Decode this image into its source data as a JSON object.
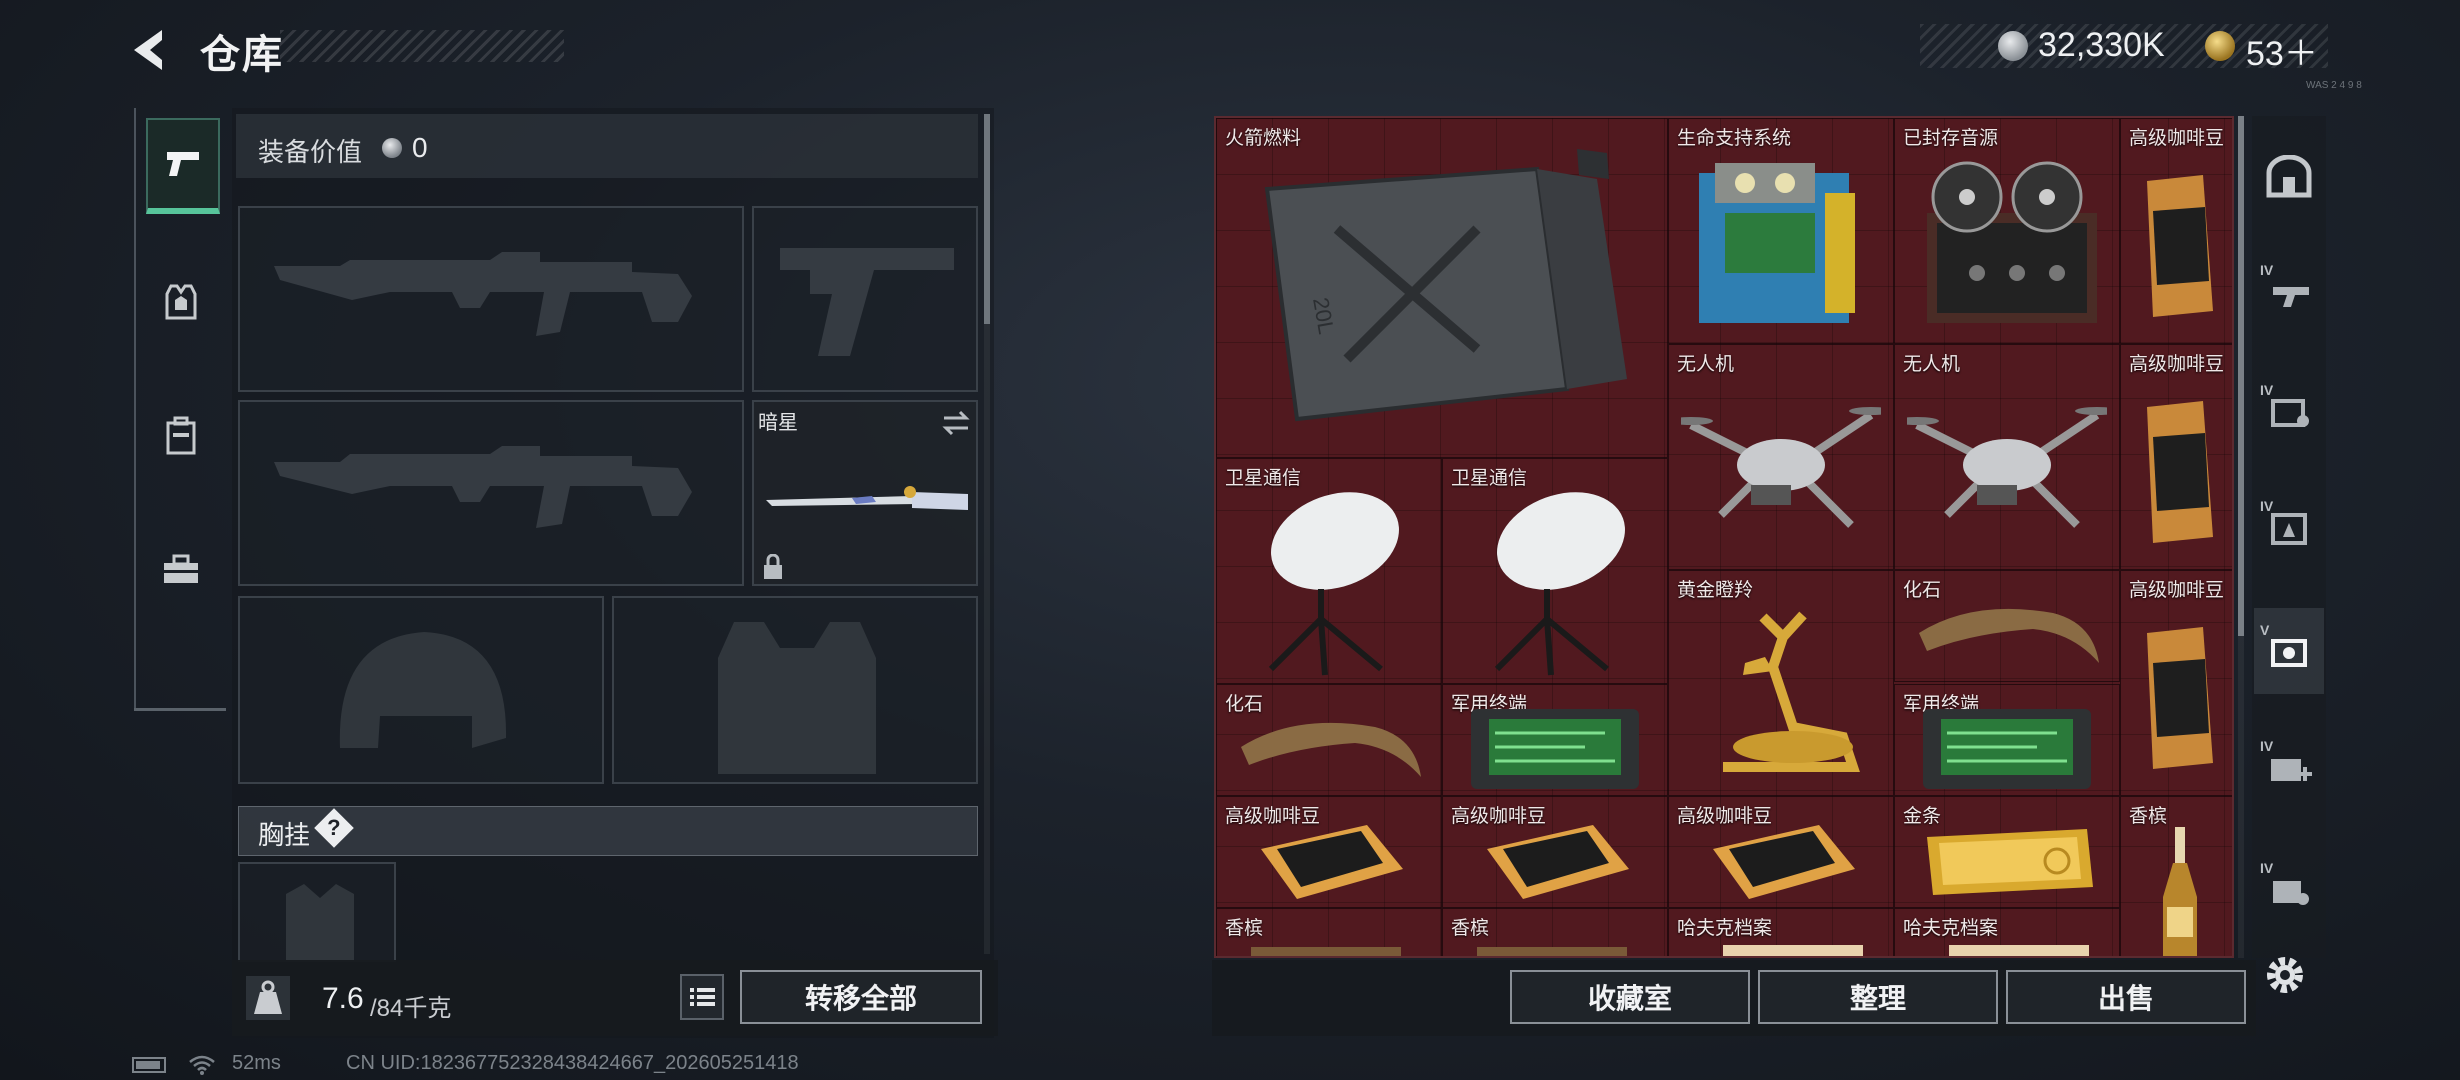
{
  "header": {
    "title": "仓库",
    "money": "32,330K",
    "tickets": "53＋",
    "tiny_text": "WAS 2 4 9 8"
  },
  "left_nav": {
    "items": [
      {
        "name": "weapon",
        "icon": "pistol-icon",
        "active": true
      },
      {
        "name": "vest",
        "icon": "vest-icon",
        "active": false
      },
      {
        "name": "backpack",
        "icon": "backpack-icon",
        "active": false
      },
      {
        "name": "toolbox",
        "icon": "toolbox-icon",
        "active": false
      }
    ]
  },
  "equipment": {
    "value_label": "装备价值",
    "value": "0",
    "knife_name": "暗星",
    "chest_rig_label": "胸挂",
    "chest_help": "?"
  },
  "left_bottom": {
    "weight_current": "7.6",
    "weight_max": "/84千克",
    "transfer_all": "转移全部"
  },
  "right_bottom": {
    "collection_room": "收藏室",
    "organize": "整理",
    "sell": "出售"
  },
  "stash_items": [
    {
      "name": "火箭燃料"
    },
    {
      "name": "生命支持系统"
    },
    {
      "name": "已封存音源"
    },
    {
      "name": "高级咖啡豆"
    },
    {
      "name": "无人机"
    },
    {
      "name": "无人机"
    },
    {
      "name": "高级咖啡豆"
    },
    {
      "name": "卫星通信"
    },
    {
      "name": "卫星通信"
    },
    {
      "name": "黄金瞪羚"
    },
    {
      "name": "化石"
    },
    {
      "name": "高级咖啡豆"
    },
    {
      "name": "化石"
    },
    {
      "name": "军用终端"
    },
    {
      "name": "军用终端"
    },
    {
      "name": "高级咖啡豆"
    },
    {
      "name": "高级咖啡豆"
    },
    {
      "name": "高级咖啡豆"
    },
    {
      "name": "金条"
    },
    {
      "name": "香槟"
    },
    {
      "name": "香槟"
    },
    {
      "name": "香槟"
    },
    {
      "name": "哈夫克档案"
    },
    {
      "name": "哈夫克档案"
    }
  ],
  "right_nav": {
    "items": [
      {
        "icon": "base-icon",
        "tier": ""
      },
      {
        "icon": "weapon-workbench-icon",
        "tier": "IV"
      },
      {
        "icon": "tech-center-icon",
        "tier": "IV"
      },
      {
        "icon": "armor-bench-icon",
        "tier": "IV"
      },
      {
        "icon": "collection-icon",
        "tier": "V"
      },
      {
        "icon": "medical-station-icon",
        "tier": "IV"
      },
      {
        "icon": "training-icon",
        "tier": "IV"
      }
    ]
  },
  "status": {
    "ping": "52ms",
    "uid": "CN UID:182367752328438424667_202605251418"
  }
}
